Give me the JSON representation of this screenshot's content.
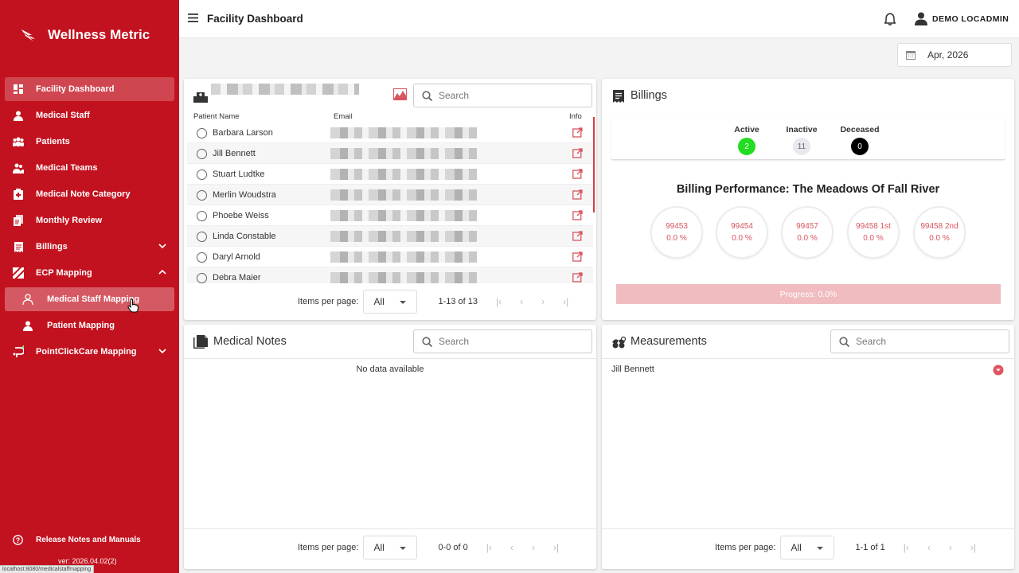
{
  "app": {
    "name": "Wellness Metric"
  },
  "sidebar": {
    "items": [
      {
        "label": "Facility Dashboard"
      },
      {
        "label": "Medical Staff"
      },
      {
        "label": "Patients"
      },
      {
        "label": "Medical Teams"
      },
      {
        "label": "Medical Note Category"
      },
      {
        "label": "Monthly Review"
      },
      {
        "label": "Billings"
      },
      {
        "label": "ECP Mapping"
      },
      {
        "label": "Medical Staff Mapping"
      },
      {
        "label": "Patient Mapping"
      },
      {
        "label": "PointClickCare Mapping"
      }
    ],
    "release_label": "Release Notes and Manuals",
    "version": "ver: 2026.04.02(2)",
    "status_url": "localhost:8080/medicalstaffmapping"
  },
  "header": {
    "title": "Facility Dashboard",
    "user": "DEMO LOCADMIN"
  },
  "date_picker": {
    "value": "Apr, 2026"
  },
  "patients_card": {
    "search_placeholder": "Search",
    "columns": [
      "Patient Name",
      "Email",
      "Info"
    ],
    "rows": [
      {
        "name": "Barbara Larson"
      },
      {
        "name": "Jill Bennett"
      },
      {
        "name": "Stuart Ludtke"
      },
      {
        "name": "Merlin Woudstra"
      },
      {
        "name": "Phoebe Weiss"
      },
      {
        "name": "Linda Constable"
      },
      {
        "name": "Daryl Arnold"
      },
      {
        "name": "Debra Maier"
      }
    ],
    "pager": {
      "items_label": "Items per page:",
      "per_page": "All",
      "range": "1-13 of 13"
    }
  },
  "billings_card": {
    "title": "Billings",
    "status": {
      "active_label": "Active",
      "active_count": "2",
      "inactive_label": "Inactive",
      "inactive_count": "11",
      "deceased_label": "Deceased",
      "deceased_count": "0"
    },
    "performance_title": "Billing Performance: The Meadows Of Fall River",
    "codes": [
      {
        "code": "99453",
        "pct": "0.0 %"
      },
      {
        "code": "99454",
        "pct": "0.0 %"
      },
      {
        "code": "99457",
        "pct": "0.0 %"
      },
      {
        "code": "99458 1st",
        "pct": "0.0 %"
      },
      {
        "code": "99458 2nd",
        "pct": "0.0 %"
      }
    ],
    "progress_label": "Progress: 0.0%",
    "progress_value": 0.0
  },
  "notes_card": {
    "title": "Medical Notes",
    "search_placeholder": "Search",
    "empty_text": "No data available",
    "pager": {
      "items_label": "Items per page:",
      "per_page": "All",
      "range": "0-0 of 0"
    }
  },
  "measurements_card": {
    "title": "Measurements",
    "search_placeholder": "Search",
    "rows": [
      {
        "name": "Jill Bennett"
      }
    ],
    "pager": {
      "items_label": "Items per page:",
      "per_page": "All",
      "range": "1-1 of 1"
    }
  },
  "colors": {
    "brand": "#c3121f",
    "active": "#22dd22",
    "accent": "#d9555f"
  }
}
